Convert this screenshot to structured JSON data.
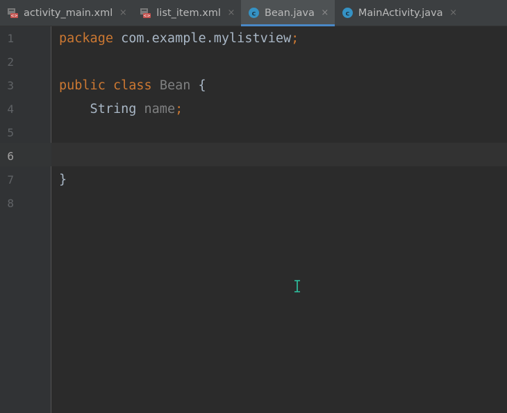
{
  "tabs": [
    {
      "label": "activity_main.xml",
      "icon": "xml-layout-icon",
      "active": false,
      "close": "×"
    },
    {
      "label": "list_item.xml",
      "icon": "xml-layout-icon",
      "active": false,
      "close": "×"
    },
    {
      "label": "Bean.java",
      "icon": "java-class-icon",
      "active": true,
      "close": "×"
    },
    {
      "label": "MainActivity.java",
      "icon": "java-class-icon",
      "active": false,
      "close": "×"
    }
  ],
  "editor": {
    "current_line": 6,
    "lines": [
      {
        "number": "1",
        "tokens": [
          {
            "t": "package",
            "k": "kw"
          },
          {
            "t": " com.example.mylistview",
            "k": "plain"
          },
          {
            "t": ";",
            "k": "kw"
          }
        ]
      },
      {
        "number": "2",
        "tokens": []
      },
      {
        "number": "3",
        "tokens": [
          {
            "t": "public",
            "k": "kw"
          },
          {
            "t": " ",
            "k": "plain"
          },
          {
            "t": "class",
            "k": "kw"
          },
          {
            "t": " ",
            "k": "plain"
          },
          {
            "t": "Bean",
            "k": "cls"
          },
          {
            "t": " {",
            "k": "plain"
          }
        ]
      },
      {
        "number": "4",
        "tokens": [
          {
            "t": "    String ",
            "k": "plain"
          },
          {
            "t": "name",
            "k": "field"
          },
          {
            "t": ";",
            "k": "kw"
          }
        ]
      },
      {
        "number": "5",
        "tokens": []
      },
      {
        "number": "6",
        "tokens": []
      },
      {
        "number": "7",
        "tokens": [
          {
            "t": "}",
            "k": "plain"
          }
        ]
      },
      {
        "number": "8",
        "tokens": []
      }
    ]
  },
  "colors": {
    "background": "#2b2b2b",
    "keyword": "#cc7832",
    "text": "#a9b7c6",
    "dim": "#7f8081",
    "tab_active_underline": "#4a88c7",
    "cursor": "#2ec7a4"
  }
}
